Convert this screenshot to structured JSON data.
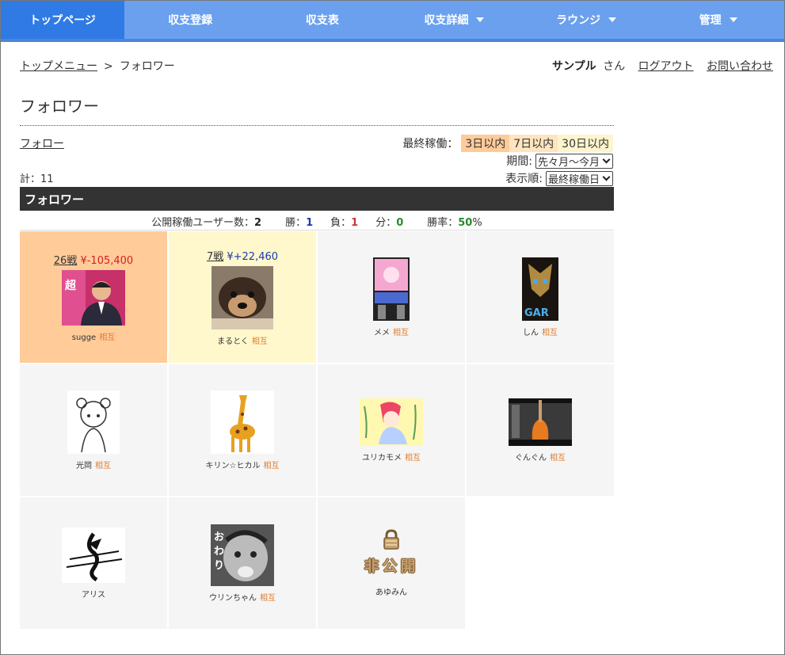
{
  "nav": {
    "items": [
      {
        "label": "トップページ",
        "dropdown": false,
        "active": true
      },
      {
        "label": "収支登録",
        "dropdown": false
      },
      {
        "label": "収支表",
        "dropdown": false
      },
      {
        "label": "収支詳細",
        "dropdown": true
      },
      {
        "label": "ラウンジ",
        "dropdown": true
      },
      {
        "label": "管理",
        "dropdown": true
      }
    ]
  },
  "breadcrumb": {
    "parent": "トップメニュー",
    "sep": ">",
    "current": "フォロワー"
  },
  "user": {
    "name": "サンプル",
    "suffix": "さん",
    "logout": "ログアウト",
    "contact": "お問い合わせ"
  },
  "page_title": "フォロワー",
  "follow_link": "フォロー",
  "total": "計：11",
  "filters": {
    "last_active_label": "最終稼働：",
    "last_active_options": [
      "3日以内",
      "7日以内",
      "30日以内"
    ],
    "period_label": "期間:",
    "period_value": "先々月～今月",
    "sort_label": "表示順:",
    "sort_value": "最終稼働日"
  },
  "section_title": "フォロワー",
  "stats": {
    "users_label": "公開稼働ユーザー数：",
    "users": "2",
    "win_label": "勝：",
    "win": "1",
    "lose_label": "負：",
    "lose": "1",
    "draw_label": "分：",
    "draw": "0",
    "rate_label": "勝率：",
    "rate": "50",
    "rate_unit": "%"
  },
  "mutual_label": "相互",
  "users": [
    {
      "name": "sugge",
      "mutual": true,
      "battles": "26戦",
      "amount": "¥-105,400",
      "sign": "neg",
      "color": "orange",
      "icon": "man-in-suit-avatar"
    },
    {
      "name": "まるとく",
      "mutual": true,
      "battles": "7戦",
      "amount": "¥+22,460",
      "sign": "pos",
      "color": "yellow",
      "icon": "dog-avatar"
    },
    {
      "name": "メメ",
      "mutual": true,
      "icon": "anime-girl-avatar"
    },
    {
      "name": "しん",
      "mutual": true,
      "icon": "garo-armor-avatar"
    },
    {
      "name": "光岡",
      "mutual": true,
      "icon": "sketch-girl-avatar"
    },
    {
      "name": "キリン☆ヒカル",
      "mutual": true,
      "icon": "giraffe-avatar"
    },
    {
      "name": "ユリカモメ",
      "mutual": true,
      "icon": "illustration-avatar"
    },
    {
      "name": "ぐんぐん",
      "mutual": true,
      "icon": "guitar-avatar"
    },
    {
      "name": "アリス",
      "mutual": false,
      "icon": "ink-figure-avatar"
    },
    {
      "name": "ウリンちゃん",
      "mutual": true,
      "icon": "manga-face-avatar"
    },
    {
      "name": "あゆみん",
      "mutual": false,
      "private": true,
      "private_label": "非公開",
      "icon": "lock-icon"
    }
  ]
}
